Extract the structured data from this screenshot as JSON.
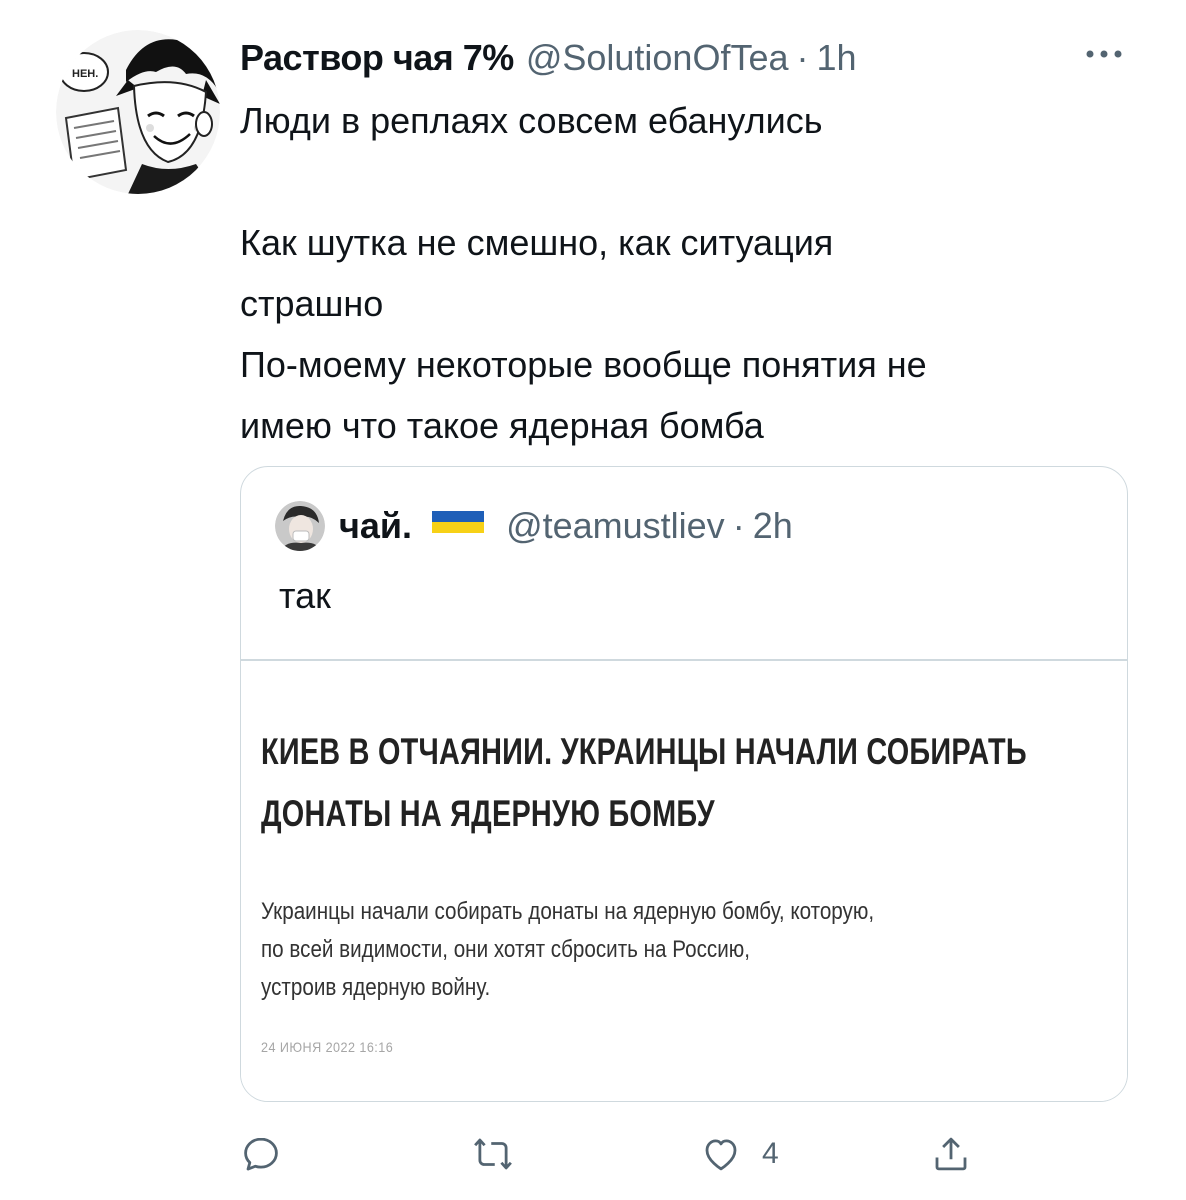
{
  "tweet": {
    "author": {
      "display_name": "Раствор чая 7%",
      "handle": "@SolutionOfTea",
      "separator": "·",
      "time": "1h",
      "avatar_caption": "НЕН."
    },
    "text_lines": [
      "Люди в реплаях совсем ебанулись",
      "",
      "Как шутка не смешно, как ситуация",
      "страшно",
      "По-моему некоторые вообще понятия не",
      "имею что такое ядерная бомба"
    ],
    "actions": {
      "reply_icon": "reply-icon",
      "retweet_icon": "retweet-icon",
      "like_icon": "like-icon",
      "like_count": "4",
      "share_icon": "share-icon"
    }
  },
  "quote": {
    "author": {
      "display_name": "чай.",
      "handle": "@teamustliev",
      "separator": "·",
      "time": "2h",
      "flag": "ukraine-flag"
    },
    "text": "так",
    "article": {
      "headline_lines": [
        "КИЕВ В ОТЧАЯНИИ. УКРАИНЦЫ НАЧАЛИ СОБИРАТЬ",
        "ДОНАТЫ НА  ЯДЕРНУЮ БОМБУ"
      ],
      "body_lines": [
        "Украинцы начали собирать донаты на ядерную бомбу, которую,",
        "по всей видимости, они хотят сбросить на Россию,",
        "устроив ядерную войну."
      ],
      "date": "24 ИЮНЯ 2022 16:16"
    }
  },
  "colors": {
    "text": "#0f1419",
    "secondary": "#536471",
    "border": "#cfd9de",
    "flag_blue": "#1f5fb8",
    "flag_yellow": "#f7d117"
  }
}
